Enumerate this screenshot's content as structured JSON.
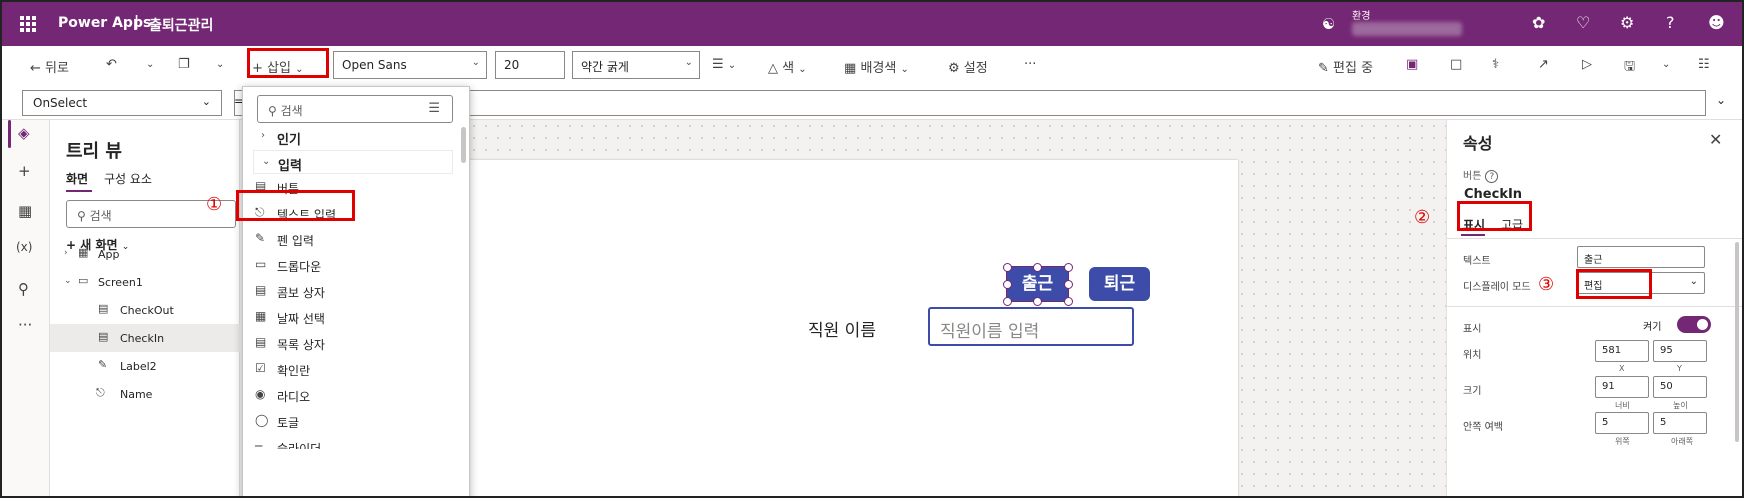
{
  "header": {
    "brand": "Power Apps",
    "separator": "|",
    "app_name": "출퇴근관리",
    "environment_label": "환경",
    "icons": [
      "environment-icon",
      "copilot-icon",
      "notifications-icon",
      "settings-icon",
      "help-icon",
      "account-icon"
    ]
  },
  "toolbar": {
    "back": "뒤로",
    "insert": "삽입",
    "font": "Open Sans",
    "font_size": "20",
    "font_weight": "약간 굵게",
    "color": "색",
    "fill": "배경색",
    "settings": "설정",
    "more": "···",
    "editing": "편집 중"
  },
  "formula_bar": {
    "property": "OnSelect",
    "equals": "="
  },
  "tree": {
    "title": "트리 뷰",
    "tabs": [
      "화면",
      "구성 요소"
    ],
    "search_placeholder": "검색",
    "new_screen": "새 화면",
    "items": [
      {
        "label": "App"
      },
      {
        "label": "Screen1"
      },
      {
        "label": "CheckOut"
      },
      {
        "label": "CheckIn"
      },
      {
        "label": "Label2"
      },
      {
        "label": "Name"
      }
    ]
  },
  "insert_menu": {
    "search_placeholder": "검색",
    "categories": [
      "인기",
      "입력"
    ],
    "items": [
      "버튼",
      "텍스트 입력",
      "펜 입력",
      "드롭다운",
      "콤보 상자",
      "날짜 선택",
      "목록 상자",
      "확인란",
      "라디오",
      "토글",
      "슬라이더"
    ]
  },
  "canvas": {
    "checkin_button": "출근",
    "checkout_button": "퇴근",
    "name_label": "직원 이름",
    "name_input_placeholder": "직원이름 입력"
  },
  "properties": {
    "title": "속성",
    "control_type": "버튼",
    "control_name": "CheckIn",
    "tabs": [
      "표시",
      "고급"
    ],
    "text_label": "텍스트",
    "text_value": "출근",
    "display_mode_label": "디스플레이 모드",
    "display_mode_value": "편집",
    "visible_label": "표시",
    "visible_toggle_label": "켜기",
    "position_label": "위치",
    "x_value": "581",
    "y_value": "95",
    "x_sub": "X",
    "y_sub": "Y",
    "size_label": "크기",
    "width_value": "91",
    "height_value": "50",
    "width_sub": "너비",
    "height_sub": "높이",
    "padding_label": "안쪽 여백",
    "padding_top_value": "5",
    "padding_bottom_value": "5",
    "padding_top_sub": "위쪽",
    "padding_bottom_sub": "아래쪽"
  },
  "annotations": {
    "step1": "①",
    "step2": "②",
    "step3": "③"
  },
  "colors": {
    "brand": "#742774",
    "button": "#3d4ca9",
    "annotation": "#e00000"
  }
}
